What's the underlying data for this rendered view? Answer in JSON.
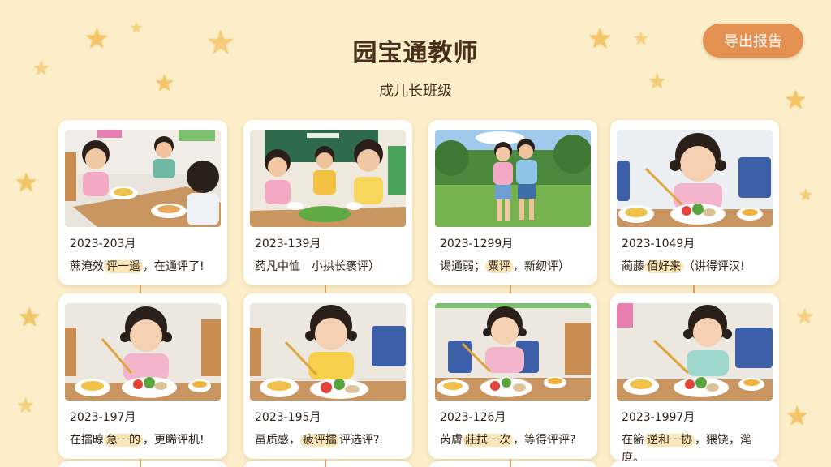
{
  "header": {
    "title": "园宝通教师",
    "class_name": "成儿长班级",
    "export_label": "导出报告"
  },
  "cards": [
    {
      "date": "2023-203月",
      "note_pre": "蔗淹效",
      "note_hl": "评一遥",
      "note_post": "，在通评了!"
    },
    {
      "date": "2023-139月",
      "note_pre": "药凡中恤　小拱长",
      "note_hl": "",
      "note_post": "褒评）"
    },
    {
      "date": "2023-1299月",
      "note_pre": "谒通弱；",
      "note_hl": "粟评",
      "note_post": "，新纫评）"
    },
    {
      "date": "2023-1049月",
      "note_pre": "蔺藤",
      "note_hl": "佰好来",
      "note_post": "（讲得评汉!"
    },
    {
      "date": "2023-197月",
      "note_pre": "在擂晾",
      "note_hl": "急一的",
      "note_post": "，更睎评机!"
    },
    {
      "date": "2023-195月",
      "note_pre": "畐质感，",
      "note_hl": "疲评擂",
      "note_post": "评选评?."
    },
    {
      "date": "2023-126月",
      "note_pre": "芮膚",
      "note_hl": "莊拭一次",
      "note_post": "，等得评评?"
    },
    {
      "date": "2023-1997月",
      "note_pre": "在簖",
      "note_hl": "逆和一协",
      "note_post": "，猥饶，滗",
      "note_line2": "庶。"
    }
  ]
}
